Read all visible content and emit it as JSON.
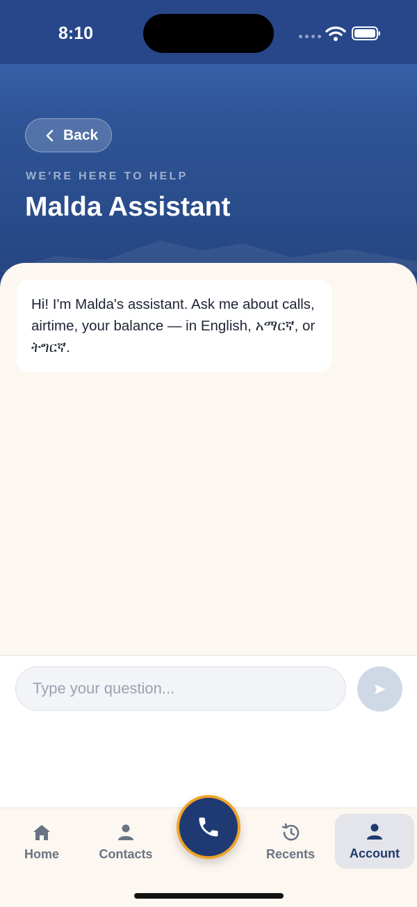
{
  "status_bar": {
    "time": "8:10"
  },
  "header": {
    "back_label": "Back",
    "eyebrow": "WE'RE HERE TO HELP",
    "title": "Malda Assistant"
  },
  "chat": {
    "messages": [
      {
        "sender": "assistant",
        "text": "Hi! I'm Malda's assistant. Ask me about calls, airtime, your balance — in English, አማርኛ, or ትግርኛ."
      }
    ]
  },
  "composer": {
    "placeholder": "Type your question..."
  },
  "tabs": [
    {
      "label": "Home",
      "icon": "home-icon"
    },
    {
      "label": "Contacts",
      "icon": "person-icon"
    },
    {
      "label": "Recents",
      "icon": "history-icon"
    },
    {
      "label": "Account",
      "icon": "person-icon",
      "selected": true
    }
  ],
  "colors": {
    "primary": "#1f3a73",
    "accent": "#f0a32a",
    "background": "#fcf7f0"
  }
}
